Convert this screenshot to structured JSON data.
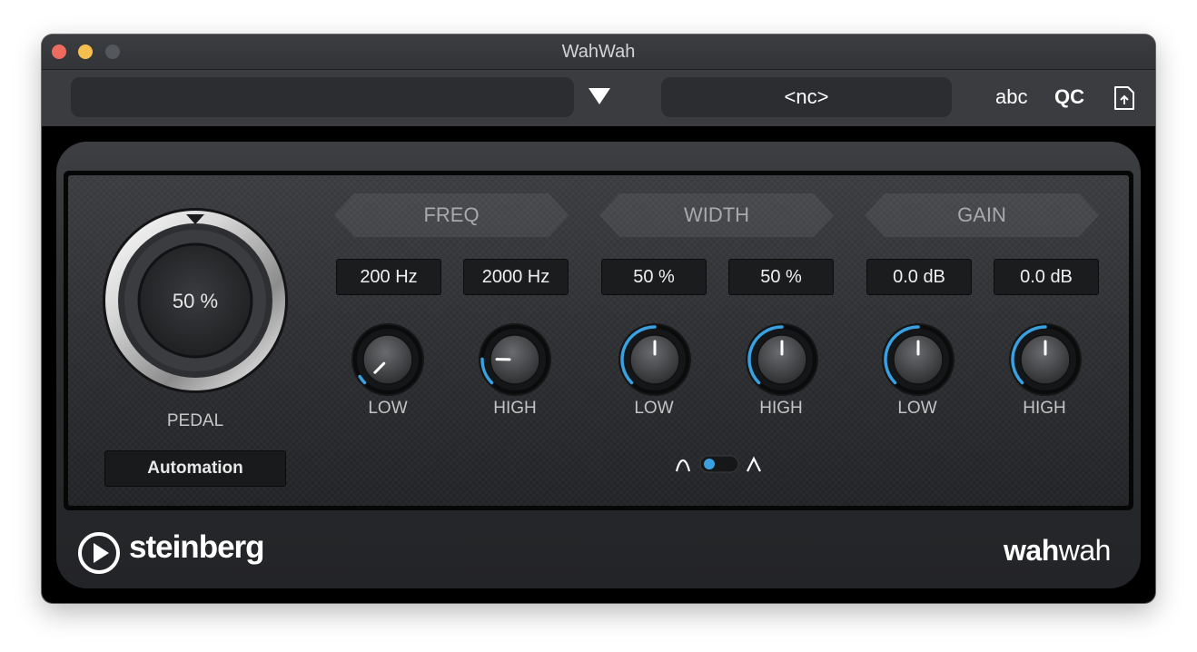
{
  "window": {
    "title": "WahWah"
  },
  "toolbar": {
    "preset_name": "",
    "nc_label": "<nc>",
    "abc_label": "abc",
    "qc_label": "QC",
    "icons": {
      "preset_menu": "triangle-down-icon",
      "export": "export-preset-icon"
    }
  },
  "pedal": {
    "value_text": "50 %",
    "label": "PEDAL",
    "automation_label": "Automation"
  },
  "sections": [
    {
      "title": "FREQ",
      "params": [
        {
          "value_text": "200 Hz",
          "label": "LOW",
          "knob_fraction": 0.0
        },
        {
          "value_text": "2000 Hz",
          "label": "HIGH",
          "knob_fraction": 0.17
        }
      ]
    },
    {
      "title": "WIDTH",
      "params": [
        {
          "value_text": "50 %",
          "label": "LOW",
          "knob_fraction": 0.5
        },
        {
          "value_text": "50 %",
          "label": "HIGH",
          "knob_fraction": 0.5
        }
      ]
    },
    {
      "title": "GAIN",
      "params": [
        {
          "value_text": "0.0 dB",
          "label": "LOW",
          "knob_fraction": 0.5
        },
        {
          "value_text": "0.0 dB",
          "label": "HIGH",
          "knob_fraction": 0.5
        }
      ]
    }
  ],
  "brand": {
    "name": "steinberg",
    "plugin_logo_bold": "wah",
    "plugin_logo_light": "wah"
  },
  "colors": {
    "accent_blue": "#3aa0e0",
    "traffic_close": "#ed6a5e",
    "traffic_minimize": "#f5bf4f"
  }
}
